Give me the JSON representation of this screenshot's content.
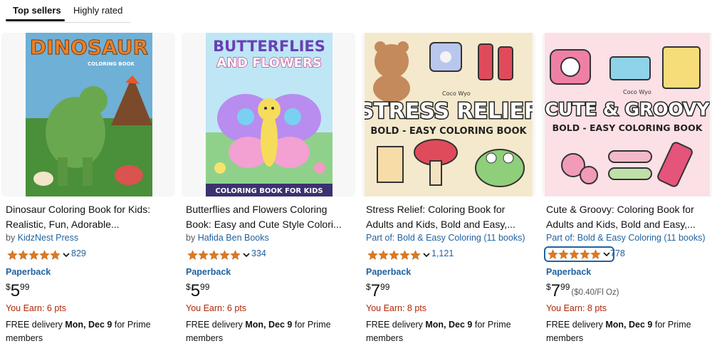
{
  "tabs": [
    {
      "label": "Top sellers",
      "active": true
    },
    {
      "label": "Highly rated",
      "active": false
    }
  ],
  "colors": {
    "link": "#2162a1",
    "earn": "#b12704",
    "star": "#de7921",
    "text": "#0f1111",
    "muted": "#565959"
  },
  "products": [
    {
      "title_line1": "Dinosaur Coloring Book for Kids:",
      "title_line2": "Realistic, Fun, Adorable...",
      "by_prefix": "by",
      "author": "KidzNest Press",
      "part_of": "",
      "rating": 5,
      "rating_count": "829",
      "format": "Paperback",
      "price_symbol": "$",
      "price_whole": "5",
      "price_fraction": "99",
      "price_unit": "",
      "earn": "You Earn: 6 pts",
      "delivery_prefix": "FREE delivery",
      "delivery_date": "Mon, Dec 9",
      "delivery_suffix": "for Prime members",
      "cover": {
        "name": "dinosaur-cover",
        "title": "DINOSAUR",
        "subtitle": "COLORING BOOK"
      }
    },
    {
      "title_line1": "Butterflies and Flowers Coloring",
      "title_line2": "Book: Easy and Cute Style Colori...",
      "by_prefix": "by",
      "author": "Hafida Ben Books",
      "part_of": "",
      "rating": 5,
      "rating_count": "334",
      "format": "Paperback",
      "price_symbol": "$",
      "price_whole": "5",
      "price_fraction": "99",
      "price_unit": "",
      "earn": "You Earn: 6 pts",
      "delivery_prefix": "FREE delivery",
      "delivery_date": "Mon, Dec 9",
      "delivery_suffix": "for Prime members",
      "cover": {
        "name": "butterflies-cover",
        "title": "BUTTERFLIES",
        "subtitle": "AND FLOWERS",
        "footer": "COLORING BOOK FOR KIDS"
      }
    },
    {
      "title_line1": "Stress Relief: Coloring Book for",
      "title_line2": "Adults and Kids, Bold and Easy,...",
      "by_prefix": "",
      "author": "",
      "part_of": "Part of: Bold & Easy Coloring (11 books)",
      "rating": 5,
      "rating_count": "1,121",
      "format": "Paperback",
      "price_symbol": "$",
      "price_whole": "7",
      "price_fraction": "99",
      "price_unit": "",
      "earn": "You Earn: 8 pts",
      "delivery_prefix": "FREE delivery",
      "delivery_date": "Mon, Dec 9",
      "delivery_suffix": "for Prime members",
      "cover": {
        "name": "stress-relief-cover",
        "brand": "Coco Wyo",
        "title": "STRESS RELIEF",
        "subtitle": "BOLD - EASY COLORING BOOK"
      }
    },
    {
      "title_line1": "Cute & Groovy: Coloring Book for",
      "title_line2": "Adults and Kids, Bold and Easy,...",
      "by_prefix": "",
      "author": "",
      "part_of": "Part of: Bold & Easy Coloring (11 books)",
      "rating": 5,
      "rating_count": "778",
      "format": "Paperback",
      "price_symbol": "$",
      "price_whole": "7",
      "price_fraction": "99",
      "price_unit": "($0.40/Fl Oz)",
      "earn": "You Earn: 8 pts",
      "delivery_prefix": "FREE delivery",
      "delivery_date": "Mon, Dec 9",
      "delivery_suffix": "for Prime members",
      "cover": {
        "name": "cute-groovy-cover",
        "brand": "Coco Wyo",
        "title": "CUTE & GROOVY",
        "subtitle": "BOLD - EASY COLORING BOOK"
      }
    }
  ]
}
